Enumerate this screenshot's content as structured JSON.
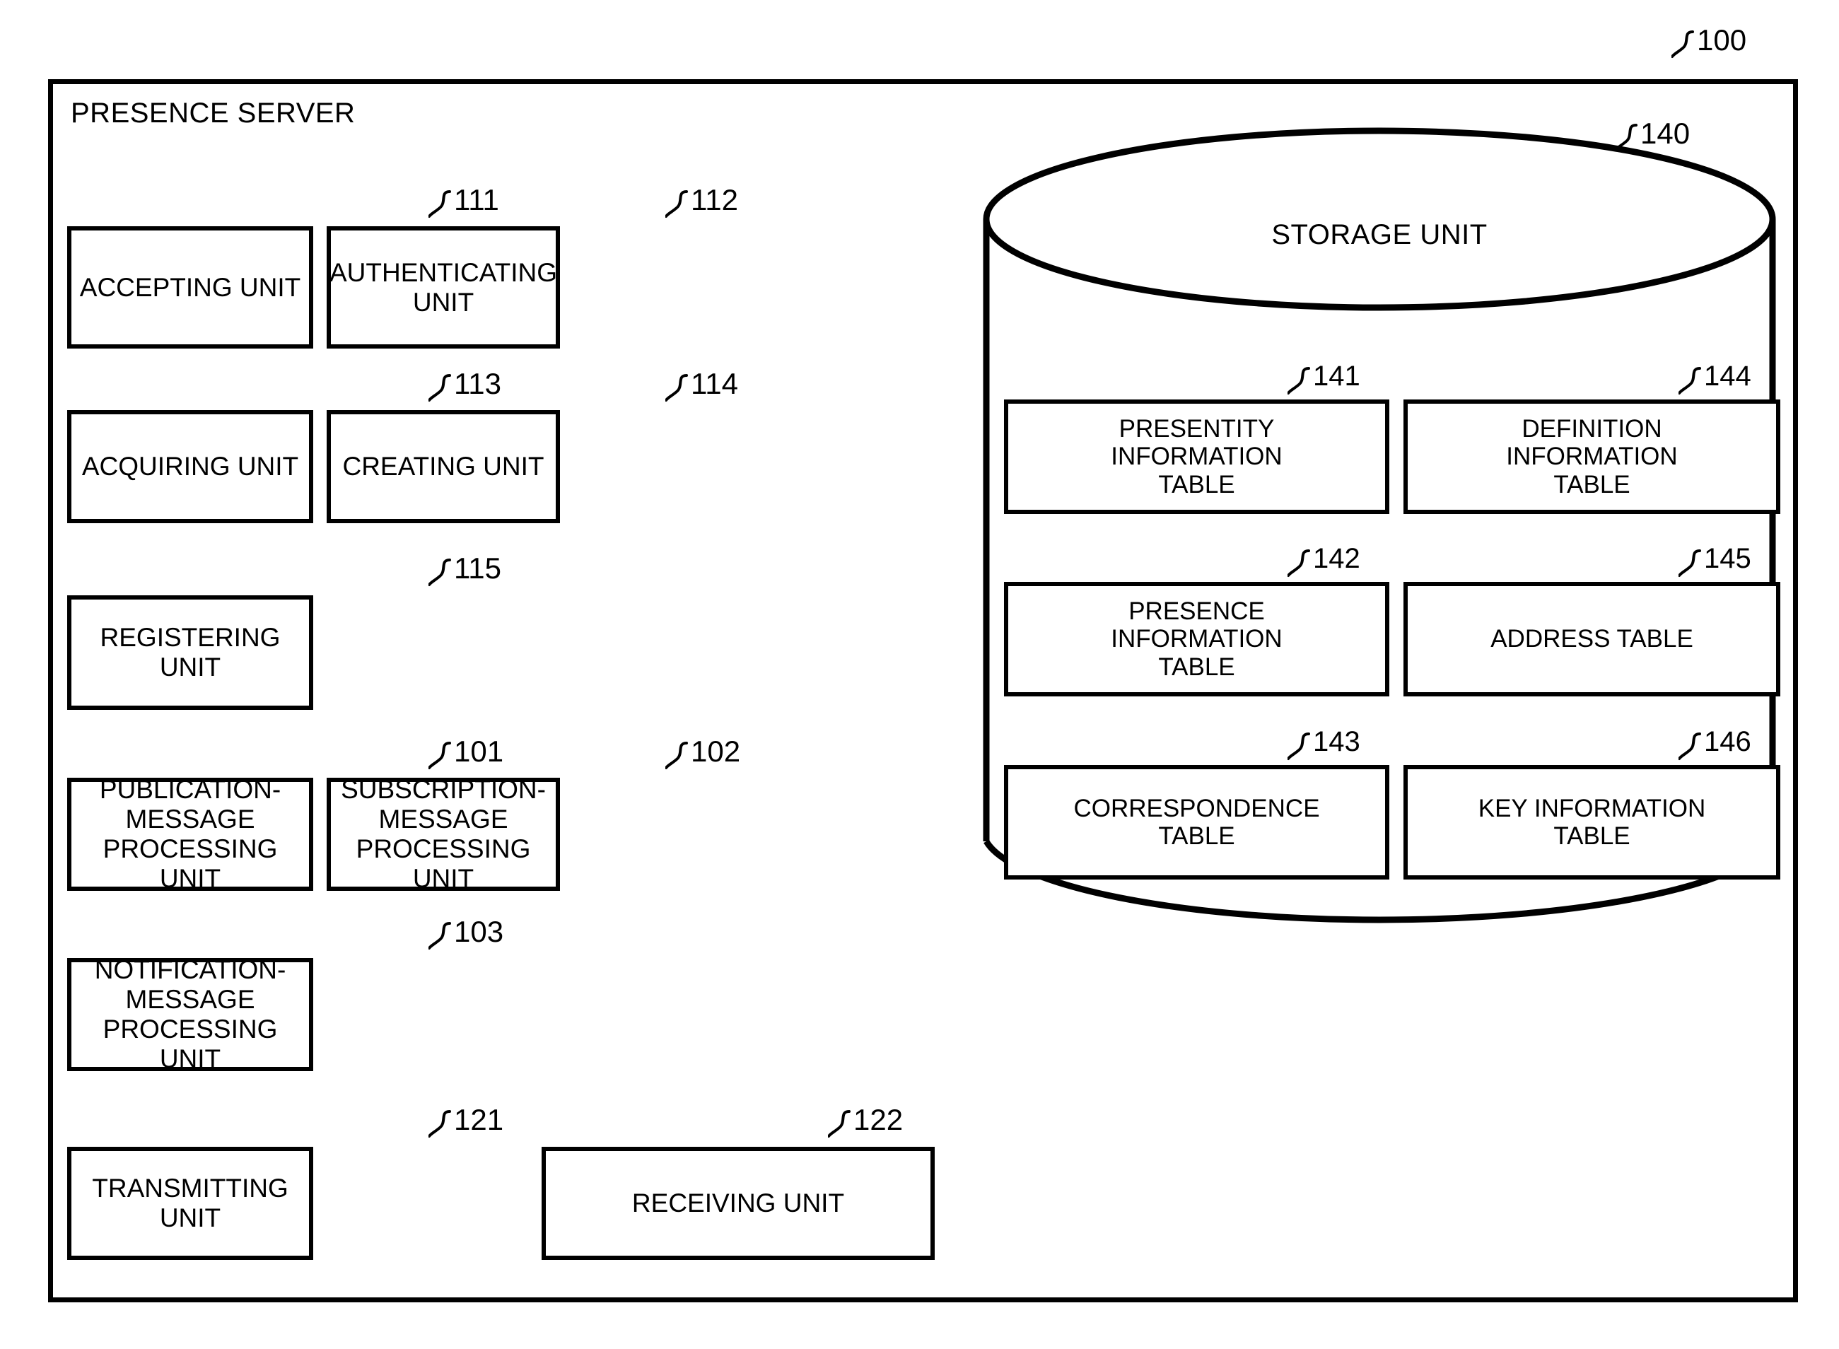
{
  "figure": {
    "frame_label": "100",
    "title": "PRESENCE SERVER"
  },
  "processing_units": [
    {
      "ref": "111",
      "label": "ACCEPTING UNIT"
    },
    {
      "ref": "112",
      "label": "AUTHENTICATING\nUNIT"
    },
    {
      "ref": "113",
      "label": "ACQUIRING UNIT"
    },
    {
      "ref": "114",
      "label": "CREATING UNIT"
    },
    {
      "ref": "115",
      "label": "REGISTERING UNIT"
    },
    {
      "ref": "101",
      "label": "PUBLICATION-\nMESSAGE\nPROCESSING UNIT"
    },
    {
      "ref": "102",
      "label": "SUBSCRIPTION-\nMESSAGE\nPROCESSING UNIT"
    },
    {
      "ref": "103",
      "label": "NOTIFICATION-\nMESSAGE\nPROCESSING UNIT"
    },
    {
      "ref": "121",
      "label": "TRANSMITTING UNIT"
    },
    {
      "ref": "122",
      "label": "RECEIVING UNIT"
    }
  ],
  "storage": {
    "ref": "140",
    "label": "STORAGE UNIT",
    "tables": [
      {
        "ref": "141",
        "label": "PRESENTITY\nINFORMATION\nTABLE"
      },
      {
        "ref": "144",
        "label": "DEFINITION\nINFORMATION\nTABLE"
      },
      {
        "ref": "142",
        "label": "PRESENCE\nINFORMATION\nTABLE"
      },
      {
        "ref": "145",
        "label": "ADDRESS TABLE"
      },
      {
        "ref": "143",
        "label": "CORRESPONDENCE\nTABLE"
      },
      {
        "ref": "146",
        "label": "KEY INFORMATION\nTABLE"
      }
    ]
  },
  "colors": {
    "ink": "#000000",
    "paper": "#ffffff"
  }
}
